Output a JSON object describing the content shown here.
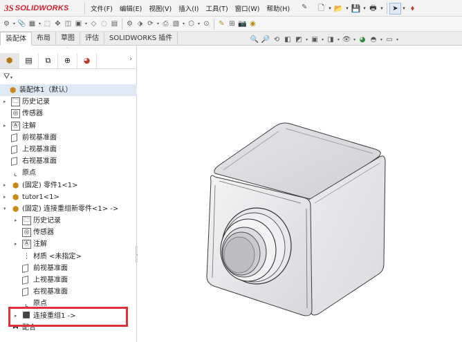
{
  "app": {
    "logo_mark": "3S",
    "logo_text": "SOLIDWORKS"
  },
  "menu": [
    "文件(F)",
    "编辑(E)",
    "视图(V)",
    "插入(I)",
    "工具(T)",
    "窗口(W)",
    "帮助(H)"
  ],
  "tabs": [
    {
      "label": "装配体",
      "active": true
    },
    {
      "label": "布局",
      "active": false
    },
    {
      "label": "草图",
      "active": false
    },
    {
      "label": "评估",
      "active": false
    },
    {
      "label": "SOLIDWORKS 插件",
      "active": false
    }
  ],
  "tree": [
    {
      "label": "装配体1（默认）",
      "icon": "assembly-icon",
      "expander": "",
      "level": 0,
      "root": true
    },
    {
      "label": "历史记录",
      "icon": "history-folder-icon",
      "expander": "▸",
      "level": 1
    },
    {
      "label": "传感器",
      "icon": "sensor-icon",
      "expander": "",
      "level": 1
    },
    {
      "label": "注解",
      "icon": "annotation-icon",
      "expander": "▸",
      "level": 1
    },
    {
      "label": "前视基准面",
      "icon": "plane-icon",
      "expander": "",
      "level": 1
    },
    {
      "label": "上视基准面",
      "icon": "plane-icon",
      "expander": "",
      "level": 1
    },
    {
      "label": "右视基准面",
      "icon": "plane-icon",
      "expander": "",
      "level": 1
    },
    {
      "label": "原点",
      "icon": "origin-icon",
      "expander": "",
      "level": 1
    },
    {
      "label": "(固定) 零件1<1>",
      "icon": "part-icon",
      "expander": "▸",
      "level": 1
    },
    {
      "label": "tutor1<1>",
      "icon": "part-icon",
      "expander": "▸",
      "level": 1
    },
    {
      "label": "(固定) 连接重组新零件<1> ->",
      "icon": "part-icon",
      "expander": "▾",
      "level": 1
    },
    {
      "label": "历史记录",
      "icon": "history-folder-icon",
      "expander": "▸",
      "level": 2
    },
    {
      "label": "传感器",
      "icon": "sensor-icon",
      "expander": "",
      "level": 2
    },
    {
      "label": "注解",
      "icon": "annotation-icon",
      "expander": "▸",
      "level": 2
    },
    {
      "label": "材质 <未指定>",
      "icon": "material-icon",
      "expander": "",
      "level": 2
    },
    {
      "label": "前视基准面",
      "icon": "plane-icon",
      "expander": "",
      "level": 2
    },
    {
      "label": "上视基准面",
      "icon": "plane-icon",
      "expander": "",
      "level": 2
    },
    {
      "label": "右视基准面",
      "icon": "plane-icon",
      "expander": "",
      "level": 2
    },
    {
      "label": "原点",
      "icon": "origin-icon",
      "expander": "",
      "level": 2
    },
    {
      "label": "连接重组1 ->",
      "icon": "join-feature-icon",
      "expander": "▸",
      "level": 2
    },
    {
      "label": "配合",
      "icon": "mates-icon",
      "expander": "",
      "level": 1
    }
  ],
  "colors": {
    "highlight": "#e0303a",
    "brand": "#d4232a",
    "selection": "#dfe9f6"
  }
}
